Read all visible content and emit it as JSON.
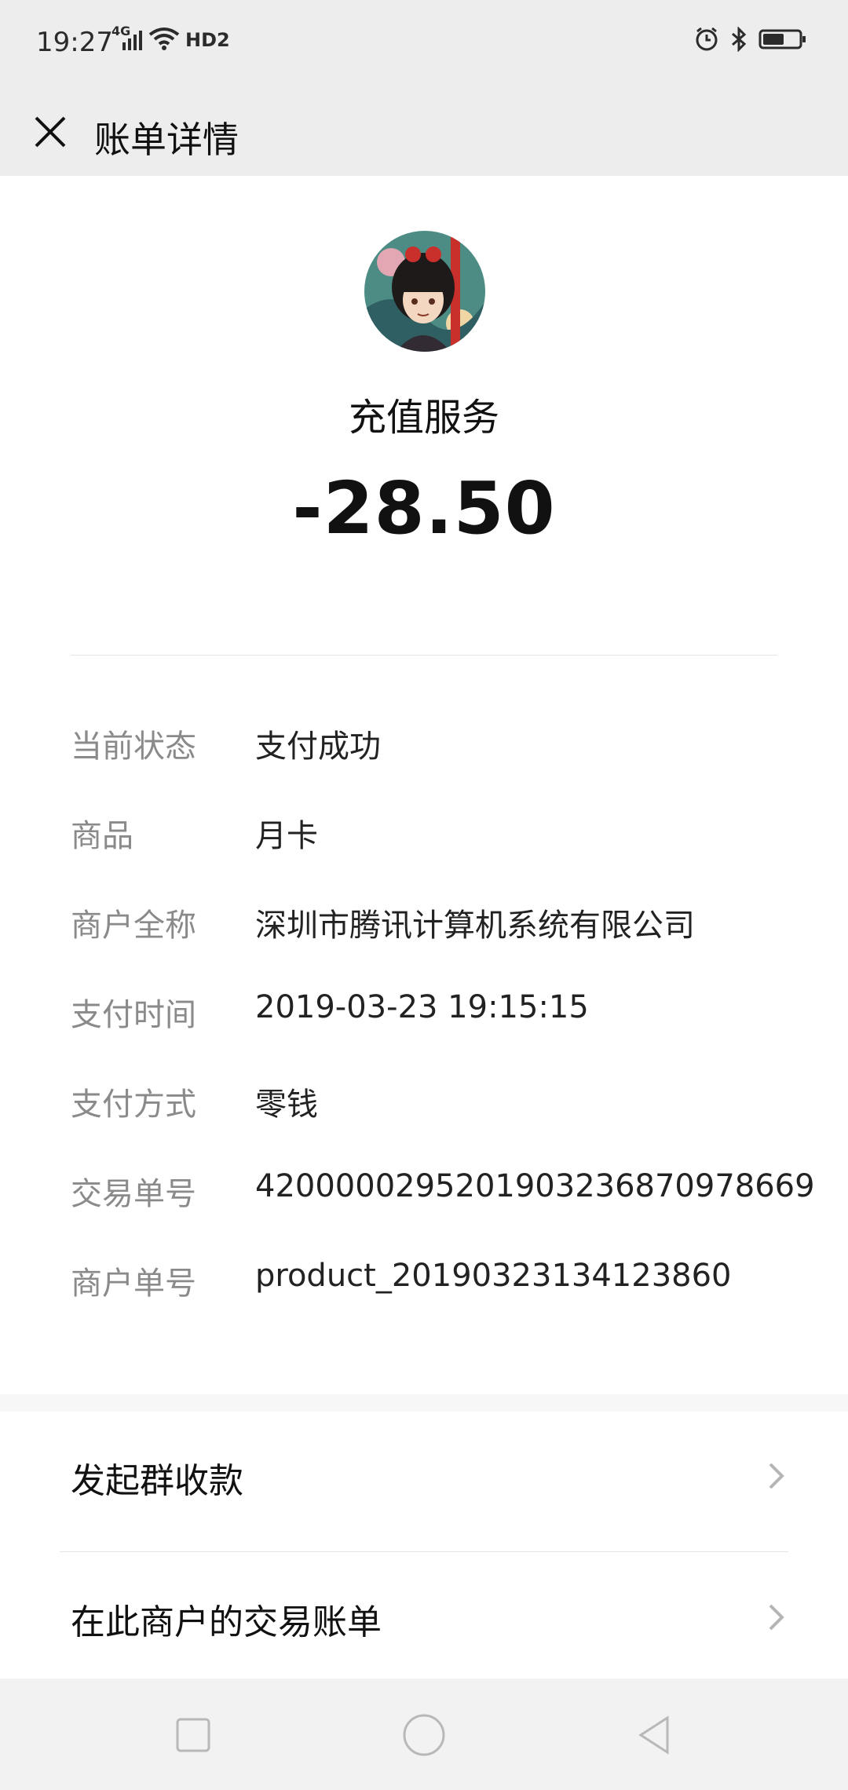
{
  "status_bar": {
    "time": "19:27",
    "network": "4G",
    "hd": "HD2",
    "icons": [
      "signal-icon",
      "wifi-icon",
      "alarm-icon",
      "bluetooth-icon",
      "battery-icon"
    ]
  },
  "header": {
    "title": "账单详情",
    "close_icon": "close-icon"
  },
  "summary": {
    "merchant_name": "充值服务",
    "amount": "-28.50"
  },
  "details": [
    {
      "label": "当前状态",
      "value": "支付成功"
    },
    {
      "label": "商品",
      "value": "月卡"
    },
    {
      "label": "商户全称",
      "value": "深圳市腾讯计算机系统有限公司"
    },
    {
      "label": "支付时间",
      "value": "2019-03-23 19:15:15"
    },
    {
      "label": "支付方式",
      "value": "零钱"
    },
    {
      "label": "交易单号",
      "value": "4200000295201903236870978669"
    },
    {
      "label": "商户单号",
      "value": "product_20190323134123860"
    }
  ],
  "actions": [
    {
      "label": "发起群收款"
    },
    {
      "label": "在此商户的交易账单"
    }
  ],
  "colors": {
    "background": "#ededed",
    "card": "#ffffff",
    "label": "#8a8a8a",
    "text": "#111111"
  }
}
